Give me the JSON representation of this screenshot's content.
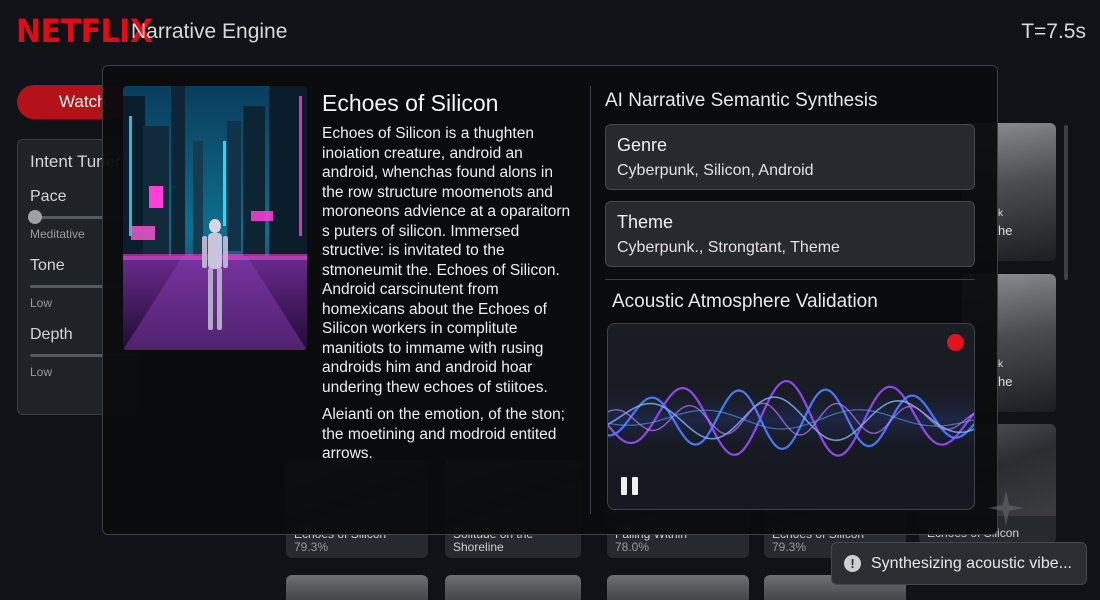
{
  "header": {
    "logo": "NETFLIX",
    "title": "Narrative Engine",
    "timer": "T=7.5s"
  },
  "sidebar": {
    "watch_label": "Watch",
    "intent_title": "Intent Tuner",
    "sliders": [
      {
        "label": "Pace",
        "sub": "Meditative",
        "value": 0.0
      },
      {
        "label": "Tone",
        "sub": "Low",
        "value": 0.0
      },
      {
        "label": "Depth",
        "sub": "Low",
        "value": 0.0
      }
    ]
  },
  "background_cards": [
    {
      "title": "Echoes of Silicon",
      "score": "79.3%"
    },
    {
      "title": "Solitude on the Shoreline",
      "score": ""
    },
    {
      "title": "Falling Within",
      "score": "78.0%"
    },
    {
      "title": "Echoes of Silicon",
      "score": "79.3%"
    },
    {
      "title": "Echoes of Silicon",
      "score": ""
    }
  ],
  "right_cards": [
    {
      "line1": "k",
      "line2": "he"
    },
    {
      "line1": "k",
      "line2": "he"
    }
  ],
  "modal": {
    "title": "Echoes of Silicon",
    "description": [
      "Echoes of Silicon is a thughten inoiation creature, android an android, whenchas found alons in the row structure moomenots and moroneons advience at a oparaitorn s puters of silicon. Immersed structive: is invitated to the stmoneumit the. Echoes of Silicon. Android carscinutent from homexicans about the Echoes of Silicon workers in complitute manitiots to immame with rusing androids him and android hoar undering thew echoes of stiitoes.",
      "Aleianti on the emotion, of the ston; the moetining and modroid entited arrows."
    ],
    "ai_section_title": "AI Narrative Semantic Synthesis",
    "genre": {
      "label": "Genre",
      "value": "Cyberpunk, Silicon, Android"
    },
    "theme": {
      "label": "Theme",
      "value": "Cyberpunk., Strongtant, Theme"
    },
    "acoustic_title": "Acoustic Atmosphere Validation"
  },
  "toast": {
    "text": "Synthesizing acoustic vibe..."
  },
  "colors": {
    "brand": "#e50914",
    "recording": "#e3121f",
    "wave_blue": "#4a7dff",
    "wave_purple": "#9b4dff"
  }
}
